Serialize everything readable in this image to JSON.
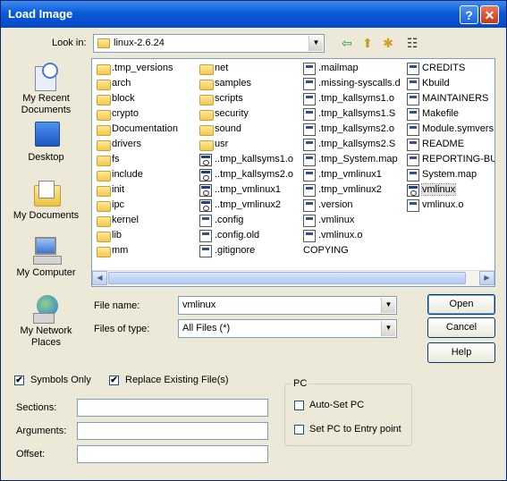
{
  "window": {
    "title": "Load Image",
    "help_glyph": "?",
    "close_glyph": "✕"
  },
  "lookin": {
    "label": "Look in:",
    "value": "linux-2.6.24",
    "arrow": "▼"
  },
  "toolbar": {
    "back_glyph": "⇦",
    "up_glyph": "⬆",
    "newfolder_glyph": "✱",
    "views_glyph": "☷"
  },
  "places": [
    {
      "label": "My Recent\nDocuments",
      "icon": "recent-documents-icon"
    },
    {
      "label": "Desktop",
      "icon": "desktop-icon"
    },
    {
      "label": "My Documents",
      "icon": "my-documents-icon"
    },
    {
      "label": "My Computer",
      "icon": "my-computer-icon"
    },
    {
      "label": "My Network\nPlaces",
      "icon": "network-places-icon"
    }
  ],
  "files": {
    "col1": [
      {
        "name": ".tmp_versions",
        "type": "folder"
      },
      {
        "name": "arch",
        "type": "folder"
      },
      {
        "name": "block",
        "type": "folder"
      },
      {
        "name": "crypto",
        "type": "folder"
      },
      {
        "name": "Documentation",
        "type": "folder"
      },
      {
        "name": "drivers",
        "type": "folder"
      },
      {
        "name": "fs",
        "type": "folder"
      },
      {
        "name": "include",
        "type": "folder"
      },
      {
        "name": "init",
        "type": "folder"
      },
      {
        "name": "ipc",
        "type": "folder"
      },
      {
        "name": "kernel",
        "type": "folder"
      },
      {
        "name": "lib",
        "type": "folder"
      },
      {
        "name": "mm",
        "type": "folder"
      }
    ],
    "col2": [
      {
        "name": "net",
        "type": "folder"
      },
      {
        "name": "samples",
        "type": "folder"
      },
      {
        "name": "scripts",
        "type": "folder"
      },
      {
        "name": "security",
        "type": "folder"
      },
      {
        "name": "sound",
        "type": "folder"
      },
      {
        "name": "usr",
        "type": "folder"
      },
      {
        "name": "..tmp_kallsyms1.o",
        "type": "exe"
      },
      {
        "name": "..tmp_kallsyms2.o",
        "type": "exe"
      },
      {
        "name": "..tmp_vmlinux1",
        "type": "exe"
      },
      {
        "name": "..tmp_vmlinux2",
        "type": "exe"
      },
      {
        "name": ".config",
        "type": "file"
      },
      {
        "name": ".config.old",
        "type": "file"
      },
      {
        "name": ".gitignore",
        "type": "file"
      }
    ],
    "col3": [
      {
        "name": ".mailmap",
        "type": "file"
      },
      {
        "name": ".missing-syscalls.d",
        "type": "file"
      },
      {
        "name": ".tmp_kallsyms1.o",
        "type": "file"
      },
      {
        "name": ".tmp_kallsyms1.S",
        "type": "file"
      },
      {
        "name": ".tmp_kallsyms2.o",
        "type": "file"
      },
      {
        "name": ".tmp_kallsyms2.S",
        "type": "file"
      },
      {
        "name": ".tmp_System.map",
        "type": "file"
      },
      {
        "name": ".tmp_vmlinux1",
        "type": "file"
      },
      {
        "name": ".tmp_vmlinux2",
        "type": "file"
      },
      {
        "name": ".version",
        "type": "file"
      },
      {
        "name": ".vmlinux",
        "type": "file"
      },
      {
        "name": ".vmlinux.o",
        "type": "file"
      },
      {
        "name": "COPYING",
        "type": "plain"
      }
    ],
    "col4": [
      {
        "name": "CREDITS",
        "type": "file"
      },
      {
        "name": "Kbuild",
        "type": "file"
      },
      {
        "name": "MAINTAINERS",
        "type": "file"
      },
      {
        "name": "Makefile",
        "type": "file"
      },
      {
        "name": "Module.symvers",
        "type": "file"
      },
      {
        "name": "README",
        "type": "file"
      },
      {
        "name": "REPORTING-BUGS",
        "type": "file"
      },
      {
        "name": "System.map",
        "type": "file"
      },
      {
        "name": "vmlinux",
        "type": "exe",
        "selected": true
      },
      {
        "name": "vmlinux.o",
        "type": "file"
      }
    ]
  },
  "scroll": {
    "left_glyph": "◀",
    "right_glyph": "▶"
  },
  "filename": {
    "label": "File name:",
    "value": "vmlinux"
  },
  "filetype": {
    "label": "Files of type:",
    "value": "All Files (*)"
  },
  "buttons": {
    "open": "Open",
    "cancel": "Cancel",
    "help": "Help"
  },
  "options": {
    "symbols_only": {
      "label": "Symbols Only",
      "checked": true
    },
    "replace_existing": {
      "label": "Replace Existing File(s)",
      "checked": true
    }
  },
  "fields": {
    "sections": "Sections:",
    "arguments": "Arguments:",
    "offset": "Offset:"
  },
  "pc_group": {
    "label": "PC",
    "auto_set": {
      "label": "Auto-Set PC",
      "checked": false
    },
    "entry_point": {
      "label": "Set PC to Entry point",
      "checked": false
    }
  },
  "check_glyph": "✔"
}
